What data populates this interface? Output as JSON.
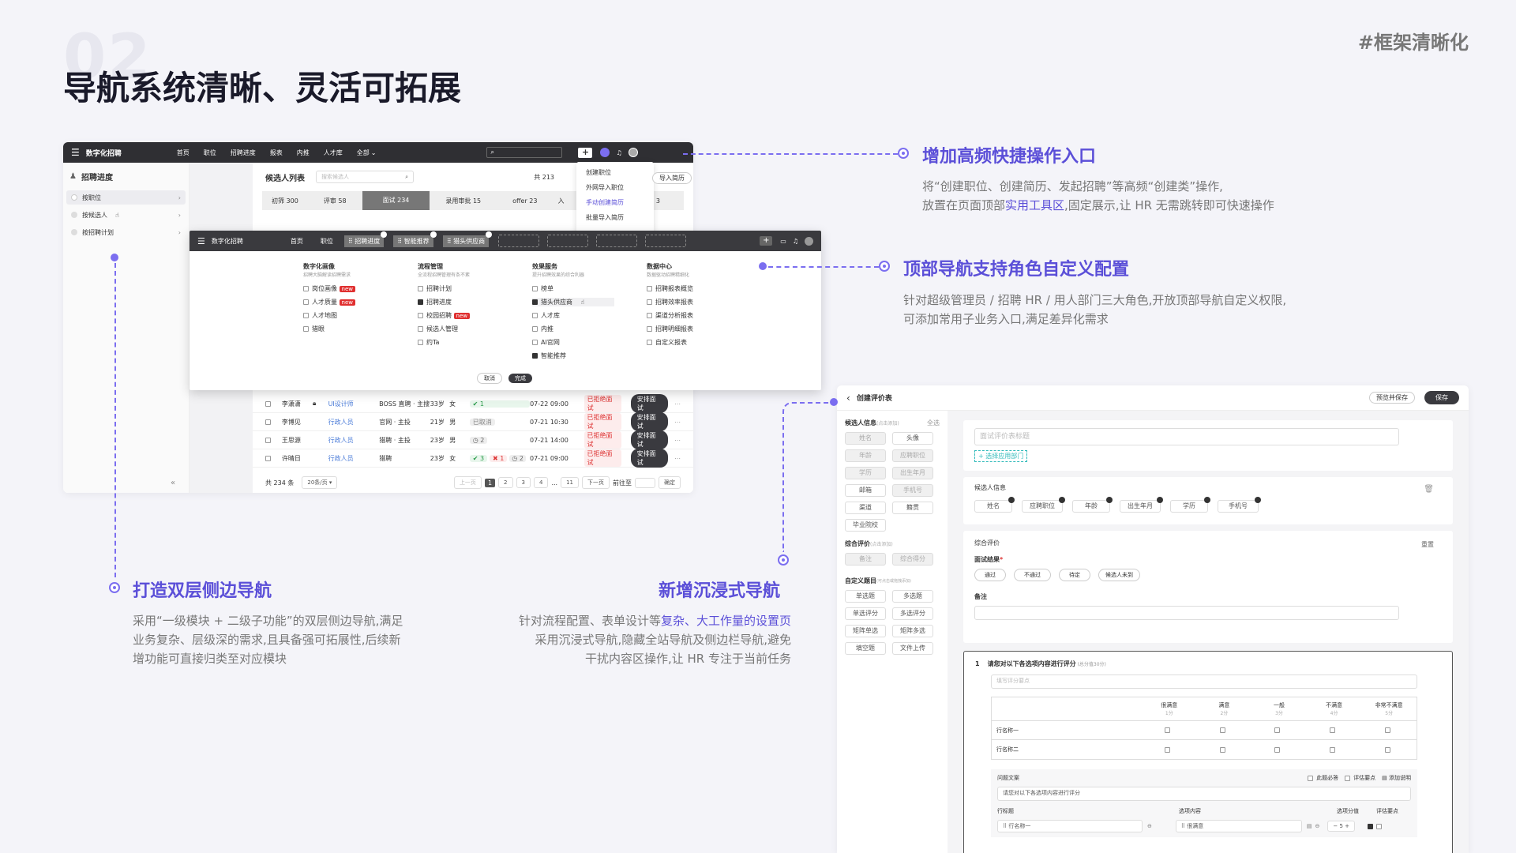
{
  "header": {
    "page_number": "02",
    "title": "导航系统清晰、灵活可拓展",
    "tag": "#框架清晰化"
  },
  "annotations": {
    "quick_entry": {
      "title": "增加高频快捷操作入口",
      "desc_1": "将“创建职位、创建简历、发起招聘”等高频“创建类”操作,",
      "desc_2a": "放置在页面顶部",
      "desc_2b": "实用工具区",
      "desc_2c": ",固定展示,让 HR 无需跳转即可快速操作"
    },
    "top_nav": {
      "title": "顶部导航支持角色自定义配置",
      "desc_1": "针对超级管理员 / 招聘 HR / 用人部门三大角色,开放顶部导航自定义权限,",
      "desc_2": "可添加常用子业务入口,满足差异化需求"
    },
    "double_sidebar": {
      "title": "打造双层侧边导航",
      "desc_1": "采用“一级模块 + 二级子功能”的双层侧边导航,满足",
      "desc_2": "业务复杂、层级深的需求,且具备强可拓展性,后续新",
      "desc_3": "增功能可直接归类至对应模块"
    },
    "immersive": {
      "title": "新增沉浸式导航",
      "desc_1a": "针对流程配置、表单设计等",
      "desc_1b": "复杂、大工作量的设置页",
      "desc_2": "采用沉浸式导航,隐藏全站导航及侧边栏导航,避免",
      "desc_3": "干扰内容区操作,让 HR 专注于当前任务"
    }
  },
  "app": {
    "brand": "数字化招聘",
    "nav": [
      "首页",
      "职位",
      "招聘进度",
      "报表",
      "内推",
      "人才库",
      "全部"
    ],
    "search_placeholder": "",
    "dropdown": [
      "创建职位",
      "外网导入职位",
      "手动创建简历",
      "批量导入简历"
    ],
    "sidebar_title": "招聘进度",
    "sidebar_items": [
      "按职位",
      "按候选人",
      "按招聘计划"
    ],
    "list_title": "候选人列表",
    "list_search": "搜索候选人",
    "count_label": "共 213",
    "import_btn": "导入简历",
    "stages": [
      {
        "label": "初筛",
        "count": "300"
      },
      {
        "label": "评审",
        "count": "58"
      },
      {
        "label": "面试",
        "count": "234"
      },
      {
        "label": "录用审批",
        "count": "15"
      },
      {
        "label": "offer",
        "count": "23"
      },
      {
        "label": "入",
        "count": ""
      }
    ],
    "stage_extra": "3",
    "rows": [
      {
        "name": "李潇潇",
        "job": "UI设计师",
        "src": "BOSS 直聘 · 主搜",
        "age": "33岁",
        "gender": "女",
        "time": "07-22 09:00",
        "status": "已拒绝面试",
        "action": "安排面试"
      },
      {
        "name": "李博见",
        "job": "行政人员",
        "src": "官网 · 主投",
        "age": "21岁",
        "gender": "男",
        "time": "07-21 10:30",
        "status": "已拒绝面试",
        "action": "安排面试"
      },
      {
        "name": "王思源",
        "job": "行政人员",
        "src": "猎聘 · 主投",
        "age": "23岁",
        "gender": "男",
        "time": "07-21 14:00",
        "status": "已拒绝面试",
        "action": "安排面试"
      },
      {
        "name": "许晴日",
        "job": "行政人员",
        "src": "猎聘",
        "age": "23岁",
        "gender": "女",
        "time": "07-21 09:00",
        "status": "已拒绝面试",
        "action": "安排面试"
      }
    ],
    "row_badges": {
      "r1": "1",
      "r2": "已取消",
      "r3": "2",
      "r4a": "3",
      "r4b": "1",
      "r4c": "2"
    },
    "footer_total": "共 234 条",
    "page_size": "20条/页",
    "pages": [
      "上一页",
      "1",
      "2",
      "3",
      "4",
      "...",
      "11",
      "下一页"
    ],
    "goto": "前往至",
    "confirm": "确定",
    "collapse_icon": "«"
  },
  "config": {
    "brand": "数字化招聘",
    "nav": [
      "首页",
      "职位"
    ],
    "chips": [
      "招聘进度",
      "智能推荐",
      "猎头供应商"
    ],
    "cols": [
      {
        "title": "数字化画像",
        "sub": "招聘大脑解读招聘需求",
        "items": [
          {
            "t": "岗位画像",
            "on": false,
            "new": true
          },
          {
            "t": "人才质量",
            "on": false,
            "new": true
          },
          {
            "t": "人才地图",
            "on": false,
            "new": false
          },
          {
            "t": "猎眼",
            "on": false,
            "new": false
          }
        ]
      },
      {
        "title": "流程管理",
        "sub": "全流程招聘管理有条不紊",
        "items": [
          {
            "t": "招聘计划",
            "on": false,
            "new": false
          },
          {
            "t": "招聘进度",
            "on": true,
            "new": false
          },
          {
            "t": "校园招聘",
            "on": false,
            "new": true
          },
          {
            "t": "候选人管理",
            "on": false,
            "new": false
          },
          {
            "t": "约Ta",
            "on": false,
            "new": false
          }
        ]
      },
      {
        "title": "效果服务",
        "sub": "提升招聘效果的综合利器",
        "items": [
          {
            "t": "榜单",
            "on": false,
            "new": false
          },
          {
            "t": "猎头供应商",
            "on": true,
            "new": false
          },
          {
            "t": "人才库",
            "on": false,
            "new": false
          },
          {
            "t": "内推",
            "on": false,
            "new": false
          },
          {
            "t": "AI官网",
            "on": false,
            "new": false
          },
          {
            "t": "智能推荐",
            "on": true,
            "new": false
          }
        ]
      },
      {
        "title": "数据中心",
        "sub": "数据驱动招聘精细化",
        "items": [
          {
            "t": "招聘报表概览",
            "on": false,
            "new": false
          },
          {
            "t": "招聘效率报表",
            "on": false,
            "new": false
          },
          {
            "t": "渠道分析报表",
            "on": false,
            "new": false
          },
          {
            "t": "招聘明细报表",
            "on": false,
            "new": false
          },
          {
            "t": "自定义报表",
            "on": false,
            "new": false
          }
        ]
      }
    ],
    "new_tag": "new",
    "cancel": "取消",
    "done": "完成"
  },
  "form": {
    "title": "创建评价表",
    "preview_save": "预览并保存",
    "save": "保存",
    "left": {
      "cand_info": "候选人信息",
      "cand_hint": "(点击添加)",
      "select_all": "全选",
      "cand_fields": [
        [
          "姓名",
          "头像"
        ],
        [
          "年龄",
          "应聘职位"
        ],
        [
          "学历",
          "出生年月"
        ],
        [
          "邮箱",
          "手机号"
        ],
        [
          "渠道",
          "籍贯"
        ],
        [
          "毕业院校",
          ""
        ]
      ],
      "overall": "综合评价",
      "overall_hint": "(点击添加)",
      "overall_fields": [
        "备注",
        "综合得分"
      ],
      "custom": "自定义题目",
      "custom_hint": "(可点击或拖拽添加)",
      "custom_fields": [
        [
          "单选题",
          "多选题"
        ],
        [
          "单选评分",
          "多选评分"
        ],
        [
          "矩阵单选",
          "矩阵多选"
        ],
        [
          "填空题",
          "文件上传"
        ]
      ]
    },
    "title_placeholder": "面试评价表标题",
    "apply_dept": "+ 选择应用部门",
    "cand_section": "候选人信息",
    "cand_chips": [
      "姓名",
      "应聘职位",
      "年龄",
      "出生年月",
      "学历",
      "手机号"
    ],
    "overall_section": "综合评价",
    "reset": "重置",
    "result_label": "面试结果",
    "results": [
      "通过",
      "不通过",
      "待定",
      "候选人未到"
    ],
    "remark": "备注",
    "q_no": "1",
    "q_title": "请您对以下各选项内容进行评分",
    "q_score": "(总分值30分)",
    "q_placeholder": "填写评分要点",
    "scale": [
      {
        "t": "很满意",
        "s": "1分"
      },
      {
        "t": "满意",
        "s": "2分"
      },
      {
        "t": "一般",
        "s": "3分"
      },
      {
        "t": "不满意",
        "s": "4分"
      },
      {
        "t": "非常不满意",
        "s": "5分"
      }
    ],
    "matrix_rows": [
      "行名称一",
      "行名称二"
    ],
    "q_copy_label": "问题文案",
    "q_required": "此题必答",
    "q_points": "评估要点",
    "q_addnote": "添加说明",
    "q_copy_value": "请您对以下各选项内容进行评分",
    "col_row_title": "行标题",
    "col_option": "选项内容",
    "col_score": "选项分值",
    "col_point": "评估要点",
    "row1_title": "行名称一",
    "row1_option": "很满意",
    "row1_score": "5"
  }
}
